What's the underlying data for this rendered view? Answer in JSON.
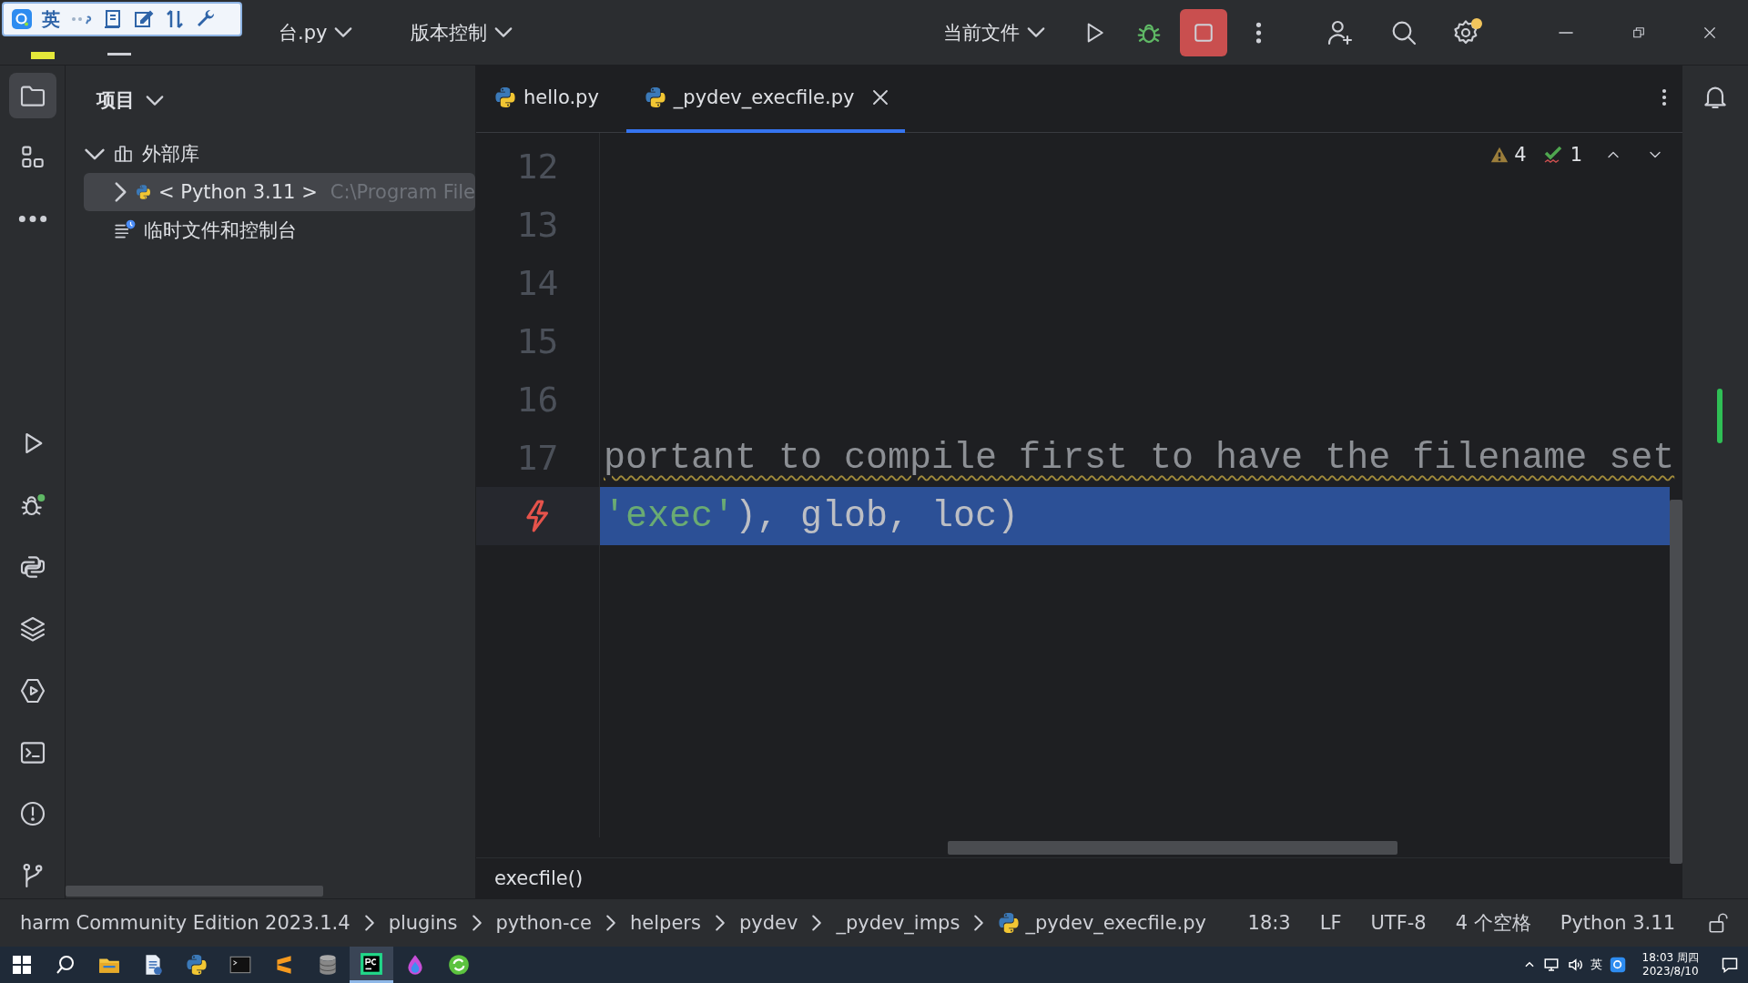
{
  "ime_toolbar": {
    "language": "英"
  },
  "title_bar": {
    "project": "台.py",
    "vcs": "版本控制",
    "run_config": "当前文件",
    "settings_notification": true,
    "stop_active": true
  },
  "tool_strip": [
    {
      "kind": "folder",
      "selected": true
    },
    {
      "kind": "structure",
      "selected": false
    },
    {
      "kind": "more",
      "selected": false
    },
    {
      "kind": "run",
      "selected": false
    },
    {
      "kind": "debug",
      "selected": false
    },
    {
      "kind": "python",
      "selected": false
    },
    {
      "kind": "layers",
      "selected": false
    },
    {
      "kind": "services",
      "selected": false
    },
    {
      "kind": "terminal",
      "selected": false
    },
    {
      "kind": "problems",
      "selected": false
    },
    {
      "kind": "git",
      "selected": false
    }
  ],
  "project_panel": {
    "title": "项目",
    "tree": [
      {
        "label": "外部库",
        "kind": "library",
        "expanded": true,
        "selected": false,
        "children": [
          {
            "label": "< Python 3.11 >",
            "hint": "C:\\Program File",
            "kind": "python",
            "expanded": false,
            "selected": true
          }
        ]
      },
      {
        "label": "临时文件和控制台",
        "kind": "scratch",
        "selected": false
      }
    ]
  },
  "tabs": [
    {
      "label": "hello.py",
      "selected": false,
      "closable": false
    },
    {
      "label": "_pydev_execfile.py",
      "selected": true,
      "closable": true
    }
  ],
  "inspections": {
    "warnings": "4",
    "ok": "1"
  },
  "lines": [
    {
      "number": "12",
      "selected": false
    },
    {
      "number": "13",
      "selected": false
    },
    {
      "number": "14",
      "selected": false
    },
    {
      "number": "15",
      "selected": false
    },
    {
      "number": "16",
      "selected": false
    },
    {
      "number": "17",
      "segments": [
        {
          "text": "portant to compile first to have the filename set",
          "kind": "comment"
        }
      ],
      "selected": false,
      "warning": true
    },
    {
      "current": true,
      "segments": [
        {
          "text": "'exec'",
          "kind": "string"
        },
        {
          "text": "), glob, loc)",
          "kind": "plain"
        }
      ],
      "selected": true
    }
  ],
  "function_breadcrumb": "execfile()",
  "status_bar": {
    "path": [
      {
        "label": "harm Community Edition 2023.1.4",
        "kind": "folder"
      },
      {
        "label": "plugins",
        "kind": "folder"
      },
      {
        "label": "python-ce",
        "kind": "folder"
      },
      {
        "label": "helpers",
        "kind": "folder"
      },
      {
        "label": "pydev",
        "kind": "folder"
      },
      {
        "label": "_pydev_imps",
        "kind": "folder"
      },
      {
        "label": "_pydev_execfile.py",
        "kind": "python"
      }
    ],
    "position": "18:3",
    "line_ending": "LF",
    "encoding": "UTF-8",
    "indent": "4 个空格",
    "interpreter": "Python 3.11"
  },
  "taskbar": {
    "apps": [
      {
        "kind": "explorer",
        "selected": false
      },
      {
        "kind": "document",
        "selected": false
      },
      {
        "kind": "python",
        "selected": false
      },
      {
        "kind": "terminal",
        "selected": false
      },
      {
        "kind": "sublime",
        "selected": false
      },
      {
        "kind": "database",
        "selected": false
      },
      {
        "kind": "pycharm",
        "selected": true
      },
      {
        "kind": "drop",
        "selected": false
      },
      {
        "kind": "sync",
        "selected": false
      }
    ],
    "input_language": "英",
    "time": "18:03 周四",
    "date": "2023/8/10"
  }
}
